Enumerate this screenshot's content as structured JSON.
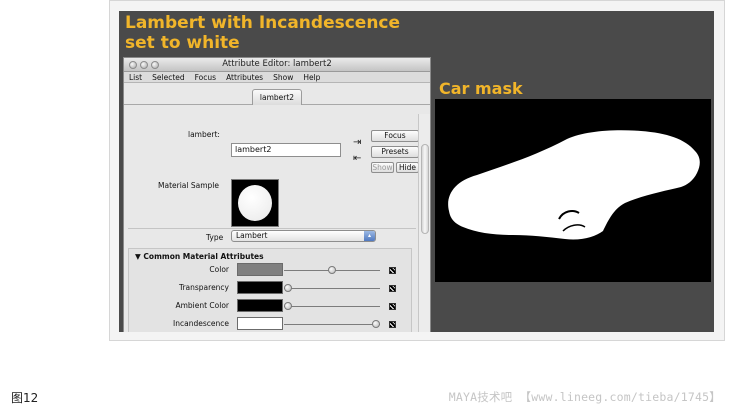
{
  "headings": {
    "left": "Lambert with Incandescence set to white",
    "right": "Car mask"
  },
  "window": {
    "title": "Attribute Editor: lambert2",
    "menu": [
      "List",
      "Selected",
      "Focus",
      "Attributes",
      "Show",
      "Help"
    ],
    "tab": "lambert2",
    "node_label": "lambert:",
    "node_value": "lambert2",
    "buttons": {
      "focus": "Focus",
      "presets": "Presets",
      "show": "Show",
      "hide": "Hide"
    },
    "material_sample_label": "Material Sample",
    "type_label": "Type",
    "type_value": "Lambert",
    "section_title": "Common Material Attributes",
    "attributes": [
      {
        "label": "Color",
        "swatch": "#808080",
        "level": 0.5
      },
      {
        "label": "Transparency",
        "swatch": "#000000",
        "level": 0.0
      },
      {
        "label": "Ambient Color",
        "swatch": "#000000",
        "level": 0.0
      },
      {
        "label": "Incandescence",
        "swatch": "#ffffff",
        "level": 1.0
      }
    ]
  },
  "colors": {
    "panel_bg": "#4a4a4a",
    "heading": "#f1b52a",
    "mask_bg": "#000000",
    "mask_shape": "#ffffff"
  },
  "footer": {
    "caption": "图12",
    "watermark": "MAYA技术吧 【www.lineeg.com/tieba/1745】"
  }
}
